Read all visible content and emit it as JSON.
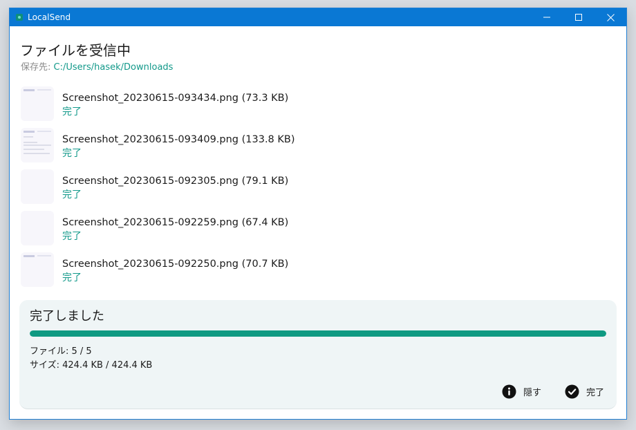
{
  "window": {
    "title": "LocalSend"
  },
  "heading": "ファイルを受信中",
  "save": {
    "label": "保存先:",
    "path": "C:/Users/hasek/Downloads"
  },
  "files": [
    {
      "name": "Screenshot_20230615-093434.png (73.3 KB)",
      "status": "完了"
    },
    {
      "name": "Screenshot_20230615-093409.png (133.8 KB)",
      "status": "完了"
    },
    {
      "name": "Screenshot_20230615-092305.png (79.1 KB)",
      "status": "完了"
    },
    {
      "name": "Screenshot_20230615-092259.png (67.4 KB)",
      "status": "完了"
    },
    {
      "name": "Screenshot_20230615-092250.png (70.7 KB)",
      "status": "完了"
    }
  ],
  "panel": {
    "title": "完了しました",
    "progress": 1.0,
    "files_line": "ファイル: 5 / 5",
    "size_line": "サイズ: 424.4 KB / 424.4 KB",
    "hide_label": "隠す",
    "done_label": "完了"
  },
  "icons": {
    "app": "localsend-logo-icon",
    "minimize": "minimize-icon",
    "maximize": "maximize-icon",
    "close": "close-icon",
    "hide": "info-icon",
    "done": "check-circle-icon"
  },
  "colors": {
    "titlebar": "#0a78d4",
    "accent": "#12998a",
    "progress": "#0f9a82",
    "panel_bg": "#eff5f6"
  }
}
